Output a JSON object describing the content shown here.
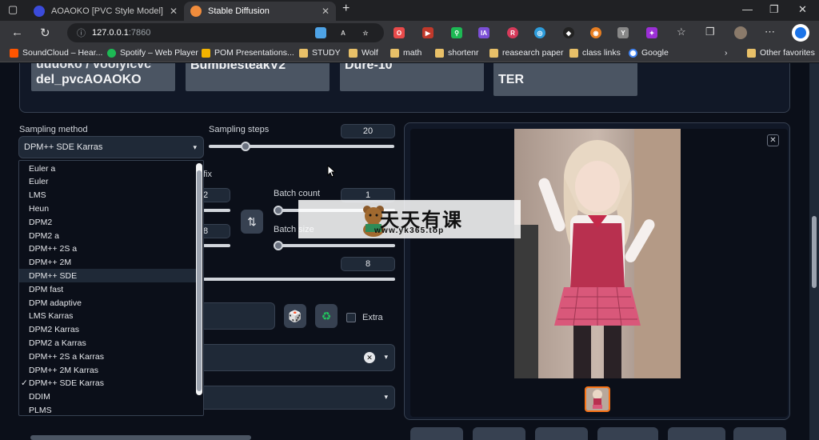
{
  "browser": {
    "tabs": [
      {
        "title": "AOAOKO [PVC Style Model] - PVC",
        "active": false
      },
      {
        "title": "Stable Diffusion",
        "active": true
      }
    ],
    "address": {
      "host": "127.0.0.1",
      "port": ":7860"
    },
    "window_controls": {
      "minimize": "—",
      "maximize": "❐",
      "close": "✕"
    },
    "new_tab": "+",
    "extensions": [
      "O",
      "▶",
      "⚲",
      "IA",
      "R",
      "◎",
      "◆",
      "◉",
      "Y",
      "✦"
    ],
    "bookmarks": [
      {
        "label": "SoundCloud – Hear..."
      },
      {
        "label": "Spotify – Web Player"
      },
      {
        "label": "POM Presentations..."
      },
      {
        "label": "STUDY"
      },
      {
        "label": "Wolf"
      },
      {
        "label": "math"
      },
      {
        "label": "shortenr"
      },
      {
        "label": "reasearch paper"
      },
      {
        "label": "class links"
      },
      {
        "label": "Google"
      }
    ],
    "other_favorites": "Other favorites"
  },
  "models": [
    {
      "line1": "uuuoko / voolyicvc",
      "line2": "del_pvcAOAOKO"
    },
    {
      "line1": "",
      "line2": "BumblesteakV2"
    },
    {
      "line1": "",
      "line2": "Dure-10"
    },
    {
      "line1": "",
      "line2": "TER"
    }
  ],
  "sampling": {
    "method_label": "Sampling method",
    "method_value": "DPM++ SDE Karras",
    "steps_label": "Sampling steps",
    "steps_value": "20",
    "steps_fraction": 0.2,
    "options": [
      "Euler a",
      "Euler",
      "LMS",
      "Heun",
      "DPM2",
      "DPM2 a",
      "DPM++ 2S a",
      "DPM++ 2M",
      "DPM++ SDE",
      "DPM fast",
      "DPM adaptive",
      "LMS Karras",
      "DPM2 Karras",
      "DPM2 a Karras",
      "DPM++ 2S a Karras",
      "DPM++ 2M Karras",
      "DPM++ SDE Karras",
      "DDIM",
      "PLMS"
    ],
    "selected_index": 16,
    "hovered_index": 8,
    "check_mark": "✓"
  },
  "settings": {
    "hires_fix_partial": "fix",
    "width_partial": "2",
    "height_partial": "8",
    "swap_icon": "⇅",
    "batch_count_label": "Batch count",
    "batch_count_value": "1",
    "batch_size_label": "Batch size",
    "cfg_value": "8",
    "extra_label": "Extra",
    "dice_icon": "🎲",
    "recycle_icon": "♻",
    "clear_icon": "✕",
    "dropdown_arrow": "▾"
  },
  "output": {
    "close_icon": "✕"
  },
  "watermark": {
    "title": "天天有课",
    "url": "www.yk365.top"
  },
  "colors": {
    "background": "#0b0f19",
    "panel": "#111827",
    "input": "#1f2937",
    "accent_orange": "#f97316",
    "recycle_green": "#22c55e"
  }
}
